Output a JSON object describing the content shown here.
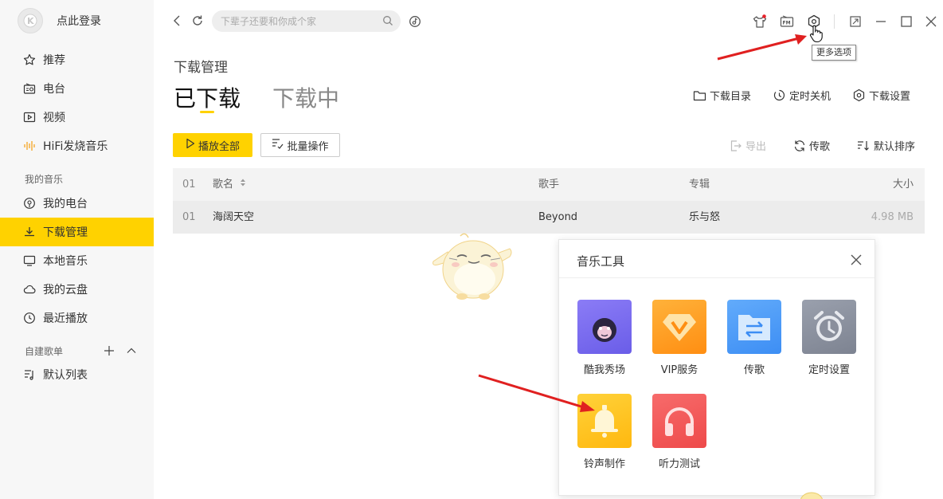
{
  "sidebar": {
    "login": "点此登录",
    "items": [
      {
        "label": "推荐",
        "icon": "star-icon"
      },
      {
        "label": "电台",
        "icon": "radio-icon"
      },
      {
        "label": "视频",
        "icon": "video-icon"
      },
      {
        "label": "HiFi发烧音乐",
        "icon": "hifi-icon"
      }
    ],
    "my_music_label": "我的音乐",
    "my_items": [
      {
        "label": "我的电台",
        "icon": "my-radio-icon"
      },
      {
        "label": "下载管理",
        "icon": "download-icon",
        "active": true
      },
      {
        "label": "本地音乐",
        "icon": "monitor-icon"
      },
      {
        "label": "我的云盘",
        "icon": "cloud-icon"
      },
      {
        "label": "最近播放",
        "icon": "clock-icon"
      }
    ],
    "playlist_label": "自建歌单",
    "playlists": [
      {
        "label": "默认列表",
        "icon": "playlist-icon"
      }
    ]
  },
  "topbar": {
    "search_placeholder": "下辈子还要和你成个家",
    "tooltip": "更多选项"
  },
  "main": {
    "page_title": "下载管理",
    "tabs": [
      {
        "label": "已下载",
        "active": true
      },
      {
        "label": "下载中",
        "active": false
      }
    ],
    "top_actions": [
      "下载目录",
      "定时关机",
      "下载设置"
    ],
    "play_all": "播放全部",
    "batch": "批量操作",
    "export": "导出",
    "transfer": "传歌",
    "sort": "默认排序",
    "table": {
      "headers": {
        "num": "01",
        "name": "歌名",
        "artist": "歌手",
        "album": "专辑",
        "size": "大小"
      },
      "rows": [
        {
          "num": "01",
          "name": "海阔天空",
          "artist": "Beyond",
          "album": "乐与怒",
          "size": "4.98 MB"
        }
      ]
    }
  },
  "panel": {
    "title": "音乐工具",
    "tools": [
      {
        "label": "酷我秀场",
        "color": "#7b6cf0"
      },
      {
        "label": "VIP服务",
        "color": "#ff9d1c"
      },
      {
        "label": "传歌",
        "color": "#4f9cf9"
      },
      {
        "label": "定时设置",
        "color": "#8a8f9c"
      },
      {
        "label": "铃声制作",
        "color": "#ffc61a"
      },
      {
        "label": "听力测试",
        "color": "#f25858"
      }
    ]
  },
  "colors": {
    "accent": "#ffd200",
    "arrow": "#e02020"
  }
}
